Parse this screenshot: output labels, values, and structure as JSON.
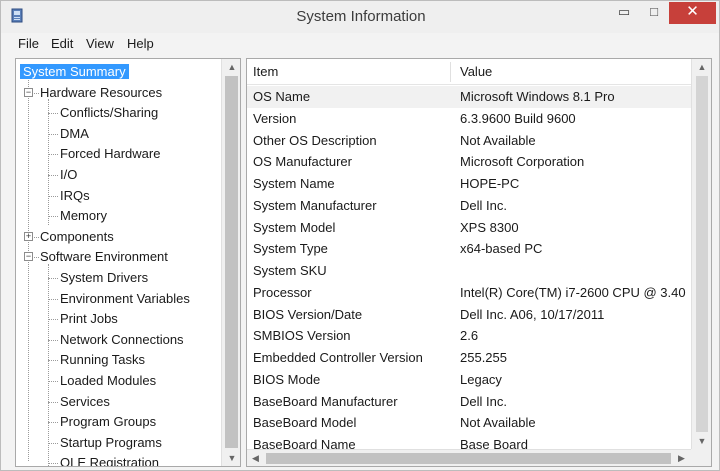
{
  "window": {
    "title": "System Information",
    "controls": {
      "minimize": "▭",
      "maximize": "□",
      "close": "✕"
    }
  },
  "menu": [
    {
      "label": "File"
    },
    {
      "label": "Edit"
    },
    {
      "label": "View"
    },
    {
      "label": "Help"
    }
  ],
  "tree": [
    {
      "label": "System Summary",
      "level": 0,
      "selected": true
    },
    {
      "label": "Hardware Resources",
      "level": 1,
      "expander": "−"
    },
    {
      "label": "Conflicts/Sharing",
      "level": 2
    },
    {
      "label": "DMA",
      "level": 2
    },
    {
      "label": "Forced Hardware",
      "level": 2
    },
    {
      "label": "I/O",
      "level": 2
    },
    {
      "label": "IRQs",
      "level": 2
    },
    {
      "label": "Memory",
      "level": 2
    },
    {
      "label": "Components",
      "level": 1,
      "expander": "+"
    },
    {
      "label": "Software Environment",
      "level": 1,
      "expander": "−"
    },
    {
      "label": "System Drivers",
      "level": 2
    },
    {
      "label": "Environment Variables",
      "level": 2
    },
    {
      "label": "Print Jobs",
      "level": 2
    },
    {
      "label": "Network Connections",
      "level": 2
    },
    {
      "label": "Running Tasks",
      "level": 2
    },
    {
      "label": "Loaded Modules",
      "level": 2
    },
    {
      "label": "Services",
      "level": 2
    },
    {
      "label": "Program Groups",
      "level": 2
    },
    {
      "label": "Startup Programs",
      "level": 2
    },
    {
      "label": "OLE Registration",
      "level": 2
    }
  ],
  "table": {
    "headers": {
      "item": "Item",
      "value": "Value"
    },
    "rows": [
      {
        "item": "OS Name",
        "value": "Microsoft Windows 8.1 Pro",
        "selected": true
      },
      {
        "item": "Version",
        "value": "6.3.9600 Build 9600"
      },
      {
        "item": "Other OS Description",
        "value": "Not Available"
      },
      {
        "item": "OS Manufacturer",
        "value": "Microsoft Corporation"
      },
      {
        "item": "System Name",
        "value": "HOPE-PC"
      },
      {
        "item": "System Manufacturer",
        "value": "Dell Inc."
      },
      {
        "item": "System Model",
        "value": "XPS 8300"
      },
      {
        "item": "System Type",
        "value": "x64-based PC"
      },
      {
        "item": "System SKU",
        "value": ""
      },
      {
        "item": "Processor",
        "value": "Intel(R) Core(TM) i7-2600 CPU @ 3.40"
      },
      {
        "item": "BIOS Version/Date",
        "value": "Dell Inc. A06, 10/17/2011"
      },
      {
        "item": "SMBIOS Version",
        "value": "2.6"
      },
      {
        "item": "Embedded Controller Version",
        "value": "255.255"
      },
      {
        "item": "BIOS Mode",
        "value": "Legacy"
      },
      {
        "item": "BaseBoard Manufacturer",
        "value": "Dell Inc."
      },
      {
        "item": "BaseBoard Model",
        "value": "Not Available"
      },
      {
        "item": "BaseBoard Name",
        "value": "Base Board"
      }
    ]
  },
  "icons": {
    "app": "system-info-icon",
    "scroll_up": "▲",
    "scroll_down": "▼",
    "scroll_left": "◀",
    "scroll_right": "▶"
  },
  "colors": {
    "selection": "#3399ff",
    "close_button": "#c7403a"
  }
}
